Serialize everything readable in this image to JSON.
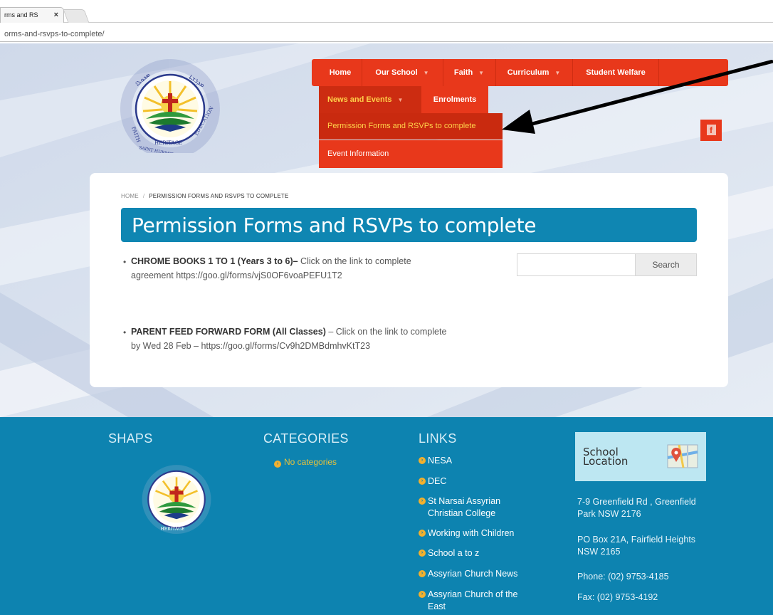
{
  "browser": {
    "tab_title": "rms and RS",
    "tab_close": "×",
    "url": "orms-and-rsvps-to-complete/"
  },
  "nav": {
    "items": [
      {
        "label": "Home"
      },
      {
        "label": "Our School",
        "has_dropdown": true
      },
      {
        "label": "Faith",
        "has_dropdown": true
      },
      {
        "label": "Curriculum",
        "has_dropdown": true
      },
      {
        "label": "Student Welfare"
      }
    ],
    "sub_items": [
      {
        "label": "News and Events",
        "has_dropdown": true,
        "active": true
      },
      {
        "label": "Enrolments"
      }
    ],
    "dropdown": [
      {
        "label": "Permission Forms and RSVPs to complete",
        "active": true
      },
      {
        "label": "Event Information"
      }
    ],
    "caret": "▼"
  },
  "social": {
    "facebook": "f"
  },
  "breadcrumb": {
    "home": "HOME",
    "separator": "/",
    "current": "PERMISSION FORMS AND RSVPS TO COMPLETE"
  },
  "page_title": "Permission Forms and RSVPs to complete",
  "content": {
    "items": [
      {
        "bold": "CHROME BOOKS 1 TO 1 (Years 3 to 6)–",
        "text_1": " Click on the link to complete",
        "text_2": "agreement  https://goo.gl/forms/vjS0OF6voaPEFU1T2"
      },
      {
        "bold": "PARENT FEED FORWARD FORM (All Classes)",
        "text_1": " – Click on the link to complete",
        "text_2": "by  Wed 28 Feb – https://goo.gl/forms/Cv9h2DMBdmhvKtT23"
      }
    ]
  },
  "search": {
    "button": "Search",
    "placeholder": ""
  },
  "footer": {
    "shaps": {
      "heading": "SHAPS"
    },
    "categories": {
      "heading": "CATEGORIES",
      "empty": "No categories"
    },
    "links": {
      "heading": "LINKS",
      "items": [
        {
          "label": "NESA"
        },
        {
          "label": "DEC"
        },
        {
          "label": "St Narsai Assyrian Christian College"
        },
        {
          "label": "Working with Children"
        },
        {
          "label": "School a to z"
        },
        {
          "label": "Assyrian Church News"
        },
        {
          "label": "Assyrian Church of the East"
        }
      ]
    },
    "location": {
      "map_label": "School Location",
      "address": "7-9 Greenfield Rd , Greenfield Park NSW 2176",
      "po_box": "PO Box 21A, Fairfield Heights NSW 2165",
      "phone": "Phone: (02) 9753-4185",
      "fax": "Fax: (02) 9753-4192"
    }
  },
  "colors": {
    "nav_red": "#e8381b",
    "active_yellow": "#ffd24a",
    "title_blue": "#0f86b2",
    "footer_blue": "#0d83b0",
    "bullet_orange": "#f2b02e"
  }
}
